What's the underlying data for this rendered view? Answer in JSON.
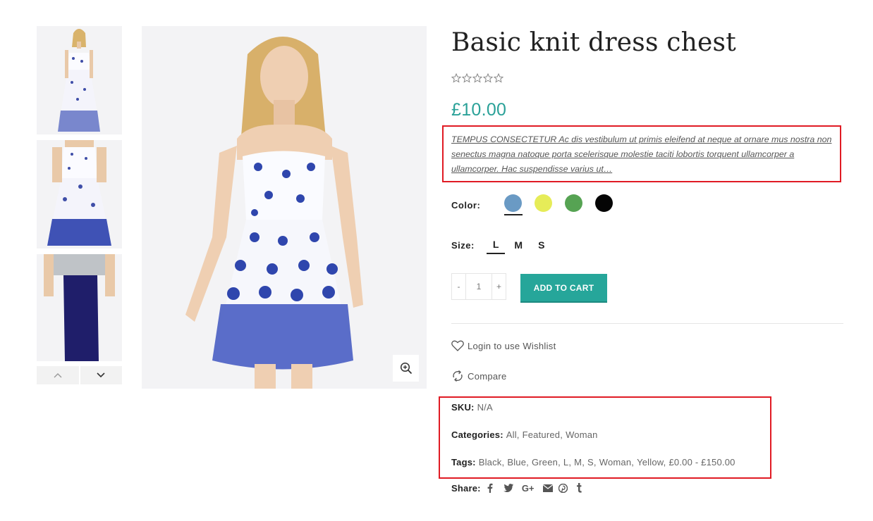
{
  "product": {
    "title": "Basic knit dress chest",
    "rating_stars": 0,
    "price": "£10.00",
    "description": "TEMPUS CONSECTETUR Ac dis vestibulum ut primis eleifend at neque at ornare mus nostra non senectus magna natoque porta scelerisque molestie taciti lobortis torquent ullamcorper a ullamcorper. Hac suspendisse varius ut…"
  },
  "gallery": {
    "thumbnails": [
      "dress-front",
      "dress-back",
      "pencil-skirt"
    ]
  },
  "color": {
    "label": "Color:",
    "swatches": [
      {
        "name": "Blue",
        "hex": "#6a9ac4",
        "selected": true
      },
      {
        "name": "Yellow",
        "hex": "#e6ec58",
        "selected": false
      },
      {
        "name": "Green",
        "hex": "#56a353",
        "selected": false
      },
      {
        "name": "Black",
        "hex": "#050505",
        "selected": false
      }
    ]
  },
  "size": {
    "label": "Size:",
    "options": [
      {
        "label": "L",
        "selected": true
      },
      {
        "label": "M",
        "selected": false
      },
      {
        "label": "S",
        "selected": false
      }
    ]
  },
  "cart": {
    "minus": "-",
    "quantity": "1",
    "plus": "+",
    "add_label": "ADD TO CART"
  },
  "actions": {
    "wishlist": "Login to use Wishlist",
    "compare": "Compare"
  },
  "meta": {
    "sku_label": "SKU:",
    "sku_value": "N/A",
    "categories_label": "Categories:",
    "categories": [
      "All",
      "Featured",
      "Woman"
    ],
    "tags_label": "Tags:",
    "tags": [
      "Black",
      "Blue",
      "Green",
      "L",
      "M",
      "S",
      "Woman",
      "Yellow",
      "£0.00 - £150.00"
    ]
  },
  "share": {
    "label": "Share:",
    "icons": [
      "facebook-icon",
      "twitter-icon",
      "google-plus-icon",
      "email-icon",
      "pinterest-icon",
      "tumblr-icon"
    ]
  },
  "colors": {
    "accent": "#26a69a",
    "price": "#2aa198",
    "highlight_border": "#e01b24"
  }
}
